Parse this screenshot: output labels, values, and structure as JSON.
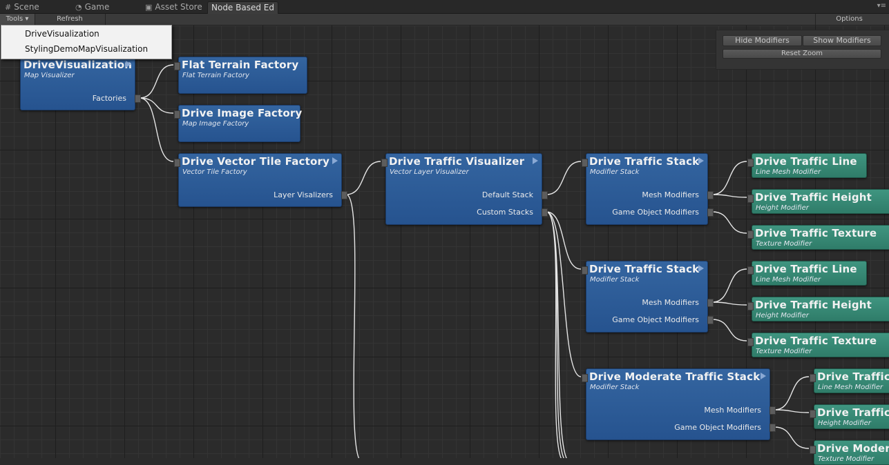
{
  "tabs": [
    {
      "label": "Scene",
      "icon": "grid-icon"
    },
    {
      "label": "Game",
      "icon": "pacman-icon"
    },
    {
      "label": "Asset Store",
      "icon": "lock-icon"
    },
    {
      "label": "Node Based Ed",
      "icon": ""
    }
  ],
  "tab_menu_icon": "panel-menu-icon",
  "toolbar": {
    "tools": "Tools",
    "refresh": "Refresh",
    "options": "Options"
  },
  "zoom_panel": {
    "hide": "Hide Modifiers",
    "show": "Show Modifiers",
    "reset": "Reset Zoom"
  },
  "dropdown": {
    "items": [
      "DriveVisualization",
      "StylingDemoMapVisualization"
    ]
  },
  "nodes": [
    {
      "title": "DriveVisualization",
      "sub": "Map Visualizer",
      "outputs": [
        "Factories"
      ]
    },
    {
      "title": "Flat Terrain Factory",
      "sub": "Flat Terrain Factory",
      "outputs": []
    },
    {
      "title": "Drive Image Factory",
      "sub": "Map Image Factory",
      "outputs": []
    },
    {
      "title": "Drive Vector Tile Factory",
      "sub": "Vector Tile Factory",
      "outputs": [
        "Layer Visalizers"
      ]
    },
    {
      "title": "Drive Traffic Visualizer",
      "sub": "Vector Layer Visualizer",
      "outputs": [
        "Default Stack",
        "Custom Stacks"
      ]
    },
    {
      "title": "Drive Traffic Stack",
      "sub": "Modifier Stack",
      "outputs": [
        "Mesh Modifiers",
        "Game Object Modifiers"
      ]
    },
    {
      "title": "Drive Traffic Stack",
      "sub": "Modifier Stack",
      "outputs": [
        "Mesh Modifiers",
        "Game Object Modifiers"
      ]
    },
    {
      "title": "Drive Moderate Traffic Stack",
      "sub": "Modifier Stack",
      "outputs": [
        "Mesh Modifiers",
        "Game Object Modifiers"
      ]
    },
    {
      "title": "Drive Traffic Line",
      "sub": "Line Mesh Modifier",
      "outputs": []
    },
    {
      "title": "Drive Traffic Height",
      "sub": "Height Modifier",
      "outputs": []
    },
    {
      "title": "Drive Traffic Texture",
      "sub": "Texture Modifier",
      "outputs": []
    },
    {
      "title": "Drive Traffic Line",
      "sub": "Line Mesh Modifier",
      "outputs": []
    },
    {
      "title": "Drive Traffic Height",
      "sub": "Height Modifier",
      "outputs": []
    },
    {
      "title": "Drive Traffic Texture",
      "sub": "Texture Modifier",
      "outputs": []
    },
    {
      "title": "Drive Traffic I",
      "sub": "Line Mesh Modifier",
      "outputs": []
    },
    {
      "title": "Drive Traffic I",
      "sub": "Height Modifier",
      "outputs": []
    },
    {
      "title": "Drive Modera",
      "sub": "Texture Modifier",
      "outputs": []
    }
  ]
}
